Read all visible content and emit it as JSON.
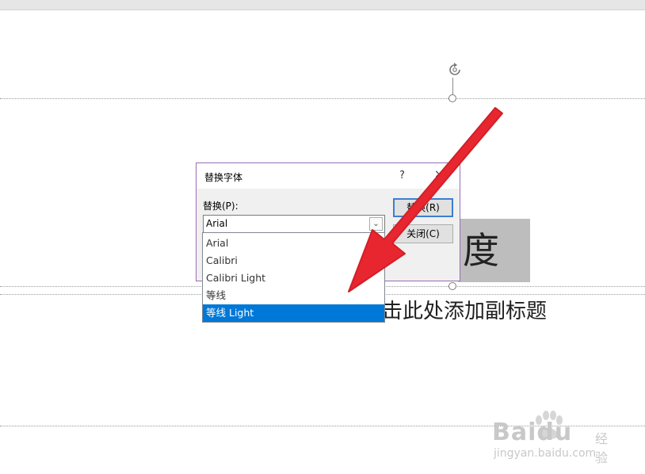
{
  "dialog": {
    "title": "替换字体",
    "help": "?",
    "close": "×",
    "replace_label": "替换(P):",
    "combo_value": "Arial",
    "replace_button": "替换(R)",
    "close_button": "关闭(C)"
  },
  "dropdown": {
    "items": [
      "Arial",
      "Calibri",
      "Calibri Light",
      "等线",
      "等线 Light"
    ],
    "selected_index": 4
  },
  "slide": {
    "title_char": "度",
    "subtitle": "击此处添加副标题"
  },
  "watermark": {
    "brand": "Baidu",
    "sub": "经验",
    "url": "jingyan.baidu.com"
  },
  "colors": {
    "arrow": "#e8262f",
    "selection": "#0078d7",
    "dialog_border": "#9b6bb5"
  }
}
